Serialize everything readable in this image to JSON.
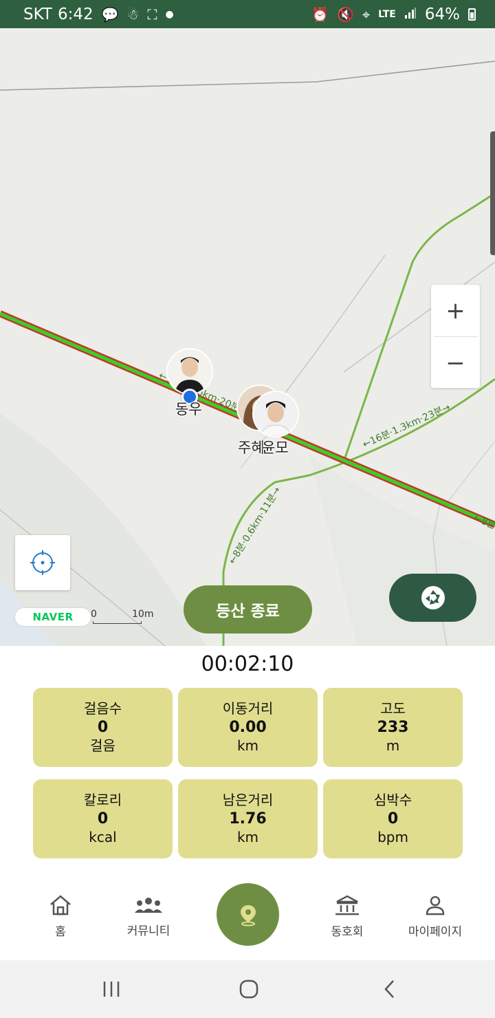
{
  "status_bar": {
    "carrier": "SKT",
    "time": "6:42",
    "network": "LTE",
    "battery": "64%",
    "icons": [
      "talk-icon",
      "notification-icon",
      "screenshot-icon",
      "dot-icon",
      "alarm-icon",
      "mute-icon",
      "location-icon",
      "signal-icon",
      "battery-icon"
    ]
  },
  "map": {
    "provider": "NAVER",
    "scale_start": "0",
    "scale_end": "10m",
    "zoom_in": "+",
    "zoom_out": "−",
    "trail_labels": [
      "←14분·0.6km·20분→",
      "←16분·1.3km·23분→",
      "←8분·0.6km·11분→",
      "←8분"
    ],
    "people": [
      {
        "name": "동우"
      },
      {
        "name": "주혜"
      },
      {
        "name": "윤모"
      }
    ],
    "end_button": "등산 종료"
  },
  "stats": {
    "timer": "00:02:10",
    "cards": [
      {
        "label": "걸음수",
        "value": "0",
        "unit": "걸음"
      },
      {
        "label": "이동거리",
        "value": "0.00",
        "unit": "km"
      },
      {
        "label": "고도",
        "value": "233",
        "unit": "m"
      },
      {
        "label": "칼로리",
        "value": "0",
        "unit": "kcal"
      },
      {
        "label": "남은거리",
        "value": "1.76",
        "unit": "km"
      },
      {
        "label": "심박수",
        "value": "0",
        "unit": "bpm"
      }
    ]
  },
  "bottom_nav": {
    "items": [
      {
        "label": "홈",
        "icon": "home-icon"
      },
      {
        "label": "커뮤니티",
        "icon": "community-icon"
      },
      {
        "label": "",
        "icon": "map-pin-icon"
      },
      {
        "label": "동호회",
        "icon": "club-icon"
      },
      {
        "label": "마이페이지",
        "icon": "person-icon"
      }
    ]
  },
  "colors": {
    "status_bar": "#2e5f3f",
    "accent": "#6e8f43",
    "camera_button": "#2e5a43",
    "card": "#e0dd8f",
    "trail_green": "#7ab648",
    "route_red": "#c0392b"
  }
}
